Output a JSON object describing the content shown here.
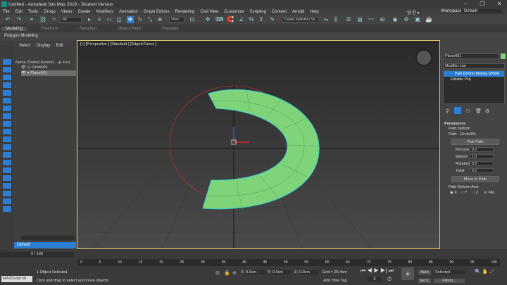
{
  "window": {
    "title": "Untitled - Autodesk 3ds Max 2018 - Student Version"
  },
  "menubar": [
    "File",
    "Edit",
    "Tools",
    "Group",
    "Views",
    "Create",
    "Modifiers",
    "Animation",
    "Graph Editors",
    "Rendering",
    "Civil View",
    "Customize",
    "Scripting",
    "Content",
    "Arnold",
    "Help"
  ],
  "account": {
    "user": "영 한 ▾",
    "workspaces_label": "Workspaces:",
    "workspace": "Default"
  },
  "toolbar": {
    "filter": "All",
    "view": "View",
    "selection_set": "Create Selection Se"
  },
  "ribbon": {
    "tabs": [
      "Modeling",
      "Freeform",
      "Selection",
      "Object Paint",
      "Populate"
    ],
    "sub_label": "Polygon Modeling"
  },
  "scene_explorer": {
    "tabs": [
      "Select",
      "Display",
      "Edit"
    ],
    "header": "Name (Sorted Ascend... ▲ Froz",
    "items": [
      "Circle001",
      "Plane001"
    ],
    "footer": "Default"
  },
  "viewport": {
    "label": "[+] [Perspective ] [Standard ] [Edged Faces ]"
  },
  "command_panel": {
    "object_name": "Plane001",
    "modifier_list": "Modifier List",
    "stack": [
      "Path Deform Binding (WSM)",
      "Editable Poly"
    ],
    "rollout": "Parameters",
    "path_deform": "Path Deform",
    "path_label": "Path:",
    "path_value": "Circle001",
    "pick_path": "Pick Path",
    "params": [
      {
        "label": "Percent",
        "value": "0.0"
      },
      {
        "label": "Stretch",
        "value": "1.0"
      },
      {
        "label": "Rotation",
        "value": "0.0"
      },
      {
        "label": "Twist",
        "value": "0.0"
      }
    ],
    "move_to_path": "Move to Path",
    "axis_label": "Path Deform Axis",
    "axes": [
      "X",
      "Y",
      "Z"
    ],
    "flip": "Flip"
  },
  "timeline": {
    "frame": "0 / 100",
    "ticks": [
      "0",
      "5",
      "10",
      "15",
      "20",
      "25",
      "30",
      "35",
      "40",
      "45",
      "50",
      "55",
      "60",
      "65",
      "70",
      "75",
      "80",
      "85",
      "90",
      "95",
      "100"
    ]
  },
  "status": {
    "script_text": "MAXScript Mi",
    "selected": "1 Object Selected",
    "prompt": "Click and drag to select and move objects",
    "x_label": "X:",
    "x": "0.0cm",
    "y_label": "Y:",
    "y": "0.0cm",
    "z_label": "Z:",
    "z": "0.0cm",
    "grid": "Grid = 25.4cm",
    "add_time_tag": "Add Time Tag",
    "auto": "Auto",
    "set_key": "Set K.",
    "selected_dd": "Selected",
    "filters": "Filters..."
  },
  "colors": {
    "accent": "#2a7fd4",
    "shape": "#7fd47a",
    "selection": "#e2c96a"
  }
}
